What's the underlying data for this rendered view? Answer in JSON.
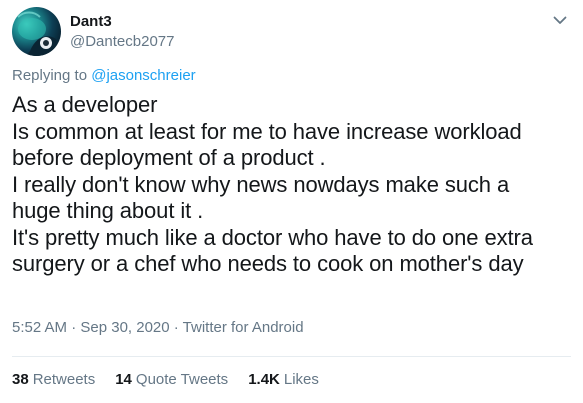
{
  "tweet": {
    "display_name": "Dant3",
    "username": "@Dantecb2077",
    "replying_prefix": "Replying to",
    "replying_to": "@jasonschreier",
    "lines": [
      "As a developer",
      "Is common at least for me to have increase workload",
      "before deployment of a product .",
      "I really don't know why news nowdays make such a",
      "huge thing about it .",
      "It's pretty much like a doctor who have to do one extra",
      "surgery or a chef who needs to cook on mother's day"
    ],
    "meta": "5:52 AM · Sep 30, 2020 · Twitter for Android",
    "stats": {
      "retweets_count": "38",
      "retweets_label": "Retweets",
      "quotes_count": "14",
      "quotes_label": "Quote Tweets",
      "likes_count": "1.4K",
      "likes_label": "Likes"
    }
  },
  "colors": {
    "text": "#14171a",
    "secondary": "#657786",
    "link": "#1da1f2",
    "divider": "#e6ecf0"
  },
  "icons": {
    "menu": "chevron-down-icon",
    "avatar": "avatar"
  }
}
